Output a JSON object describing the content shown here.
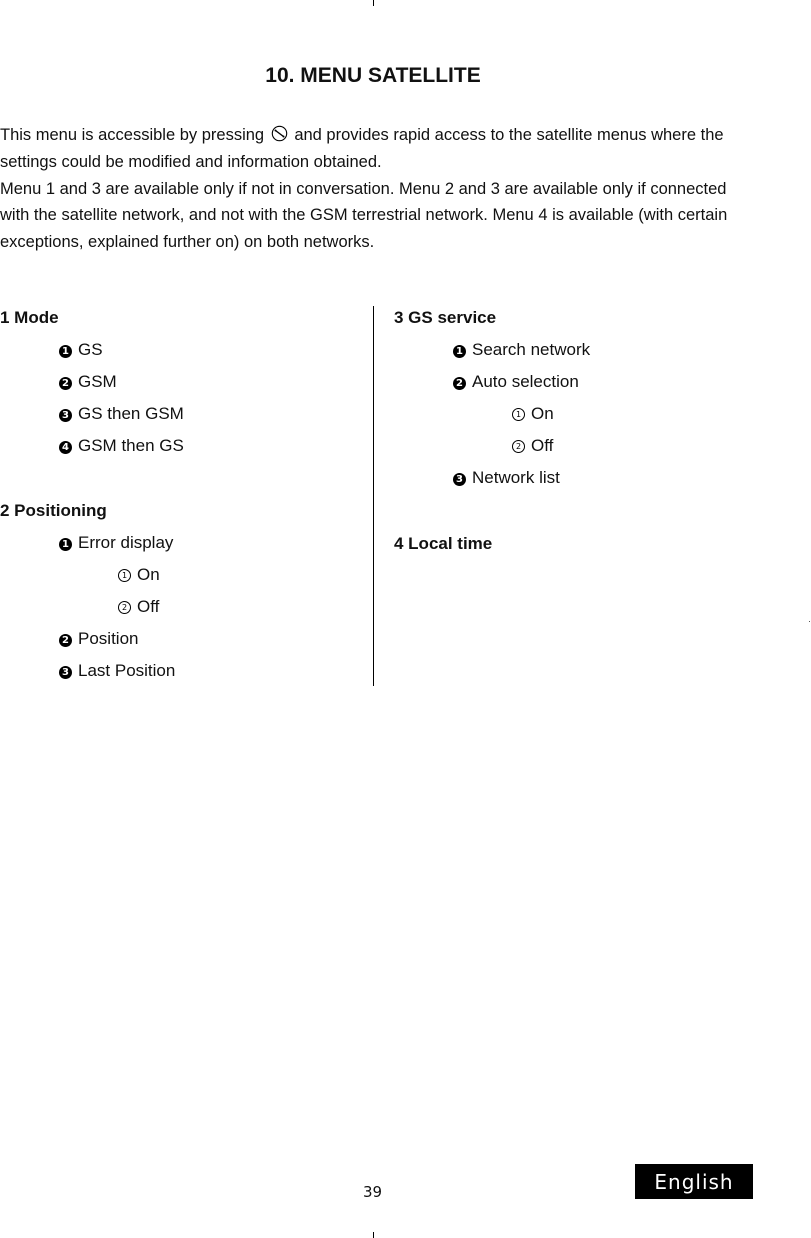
{
  "page": {
    "title": "10. MENU SATELLITE",
    "intro": {
      "line1_before_icon": "This menu is accessible by pressing",
      "button_icon": "satellite-key-icon",
      "line1_after_icon": "and provides rapid access to the satellite menus where the settings could be modified and information obtained.",
      "paragraph2": "Menu 1 and 3 are available only if not in conversation. Menu 2 and 3 are available only if connected with the satellite network, and not with the GSM terrestrial network. Menu 4 is available (with certain exceptions, explained further on) on both networks."
    },
    "left_column": {
      "menu1": {
        "heading": "1 Mode",
        "items": [
          {
            "marker": "1",
            "label": "GS"
          },
          {
            "marker": "2",
            "label": "GSM"
          },
          {
            "marker": "3",
            "label": "GS then GSM"
          },
          {
            "marker": "4",
            "label": "GSM then GS"
          }
        ]
      },
      "menu2": {
        "heading": "2 Positioning",
        "items": [
          {
            "marker": "1",
            "label": "Error display",
            "sub": [
              {
                "marker": "1",
                "label": "On"
              },
              {
                "marker": "2",
                "label": "Off"
              }
            ]
          },
          {
            "marker": "2",
            "label": "Position"
          },
          {
            "marker": "3",
            "label": "Last Position"
          }
        ]
      }
    },
    "right_column": {
      "menu3": {
        "heading": "3 GS service",
        "items": [
          {
            "marker": "1",
            "label": "Search network"
          },
          {
            "marker": "2",
            "label": "Auto selection",
            "sub": [
              {
                "marker": "1",
                "label": "On"
              },
              {
                "marker": "2",
                "label": "Off"
              }
            ]
          },
          {
            "marker": "3",
            "label": "Network list"
          }
        ]
      },
      "menu4": {
        "heading": "4 Local time"
      }
    },
    "footer": {
      "page_number": "39",
      "language": "English"
    }
  }
}
